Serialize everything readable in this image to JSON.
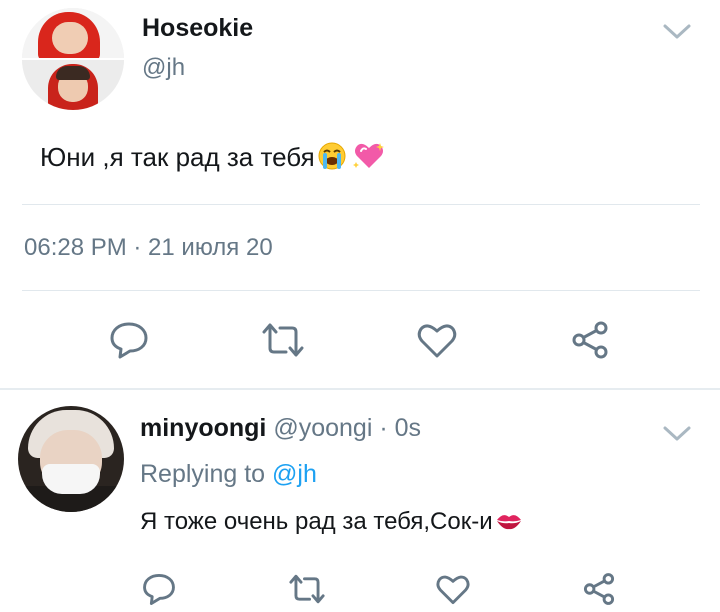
{
  "main_tweet": {
    "author_name": "Hoseokie",
    "author_handle": "@jh",
    "text": "Юни ,я так рад за тебя",
    "emojis": [
      "loudly-crying-face-emoji",
      "sparkling-heart-emoji"
    ],
    "timestamp": "06:28 PM · 21 июля 20"
  },
  "reply_tweet": {
    "author_name": "minyoongi",
    "author_meta": "@yoongi · 0s",
    "replying_prefix": "Replying to",
    "replying_mention": "@jh",
    "text": "Я тоже очень рад за тебя,Сок-и",
    "emojis": [
      "kiss-mark-emoji"
    ]
  },
  "icons": {
    "reply": "reply-icon",
    "retweet": "retweet-icon",
    "like": "heart-icon",
    "share": "share-icon",
    "menu": "chevron-down-icon"
  },
  "colors": {
    "text": "#14171a",
    "secondary": "#657786",
    "link": "#1da1f2",
    "icon": "#657786",
    "divider": "#e1e8ed"
  }
}
